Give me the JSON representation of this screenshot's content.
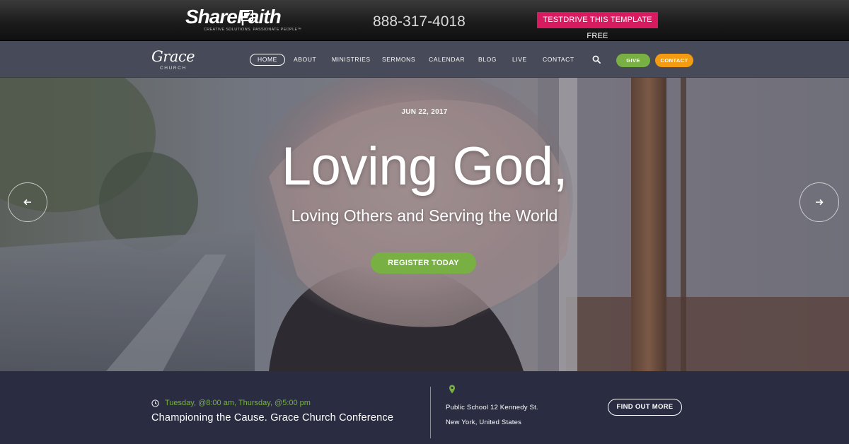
{
  "promo_bar": {
    "brand": "ShareFaith",
    "brand_tagline": "CREATIVE SOLUTIONS. PASSIONATE PEOPLE™",
    "phone": "888-317-4018",
    "testdrive_label": "TESTDRIVE THIS TEMPLATE FREE",
    "testdrive_color": "#d81b60"
  },
  "navbar": {
    "logo_script": "Grace",
    "logo_sub": "CHURCH",
    "items": [
      {
        "label": "HOME",
        "active": true
      },
      {
        "label": "ABOUT"
      },
      {
        "label": "MINISTRIES"
      },
      {
        "label": "SERMONS"
      },
      {
        "label": "CALENDAR"
      },
      {
        "label": "BLOG"
      },
      {
        "label": "LIVE"
      },
      {
        "label": "CONTACT"
      }
    ],
    "search_icon": "search-icon",
    "give_label": "GIVE",
    "contact_label": "CONTACT",
    "give_color": "#78b043",
    "contact_color": "#f39c12"
  },
  "hero": {
    "date": "JUN 22, 2017",
    "title": "Loving God,",
    "subtitle": "Loving Others and Serving the World",
    "cta_label": "REGISTER TODAY",
    "prev_icon": "arrow-left-icon",
    "next_icon": "arrow-right-icon"
  },
  "event": {
    "time": "Tuesday, @8:00 am, Thursday, @5:00 pm",
    "title": "Championing the Cause. Grace Church Conference",
    "address_line1": "Public School 12 Kennedy St.",
    "address_line2": "New York, United States",
    "cta_label": "FIND OUT MORE",
    "accent_color": "#78b043"
  }
}
